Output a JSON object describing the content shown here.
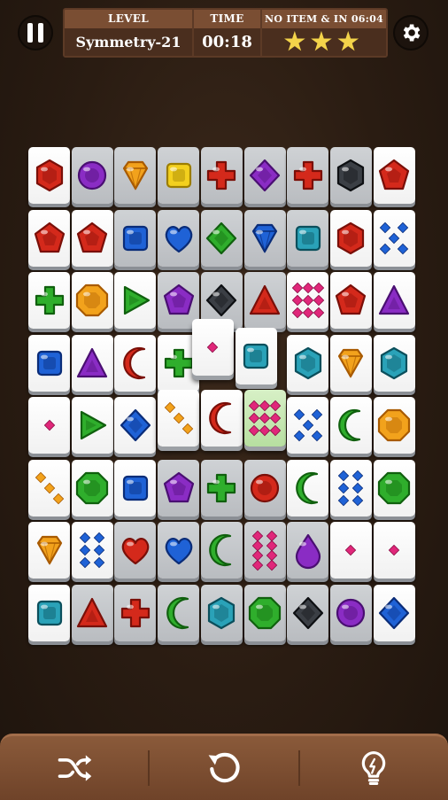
{
  "hud": {
    "level_label": "LEVEL",
    "level_value": "Symmetry-21",
    "time_label": "TIME",
    "time_value": "00:18",
    "goal_label": "NO ITEM & IN 06:04",
    "stars": "★★★"
  },
  "icons": {
    "pause": "pause-icon",
    "settings": "gear-icon",
    "shuffle": "shuffle-icon",
    "undo": "undo-icon",
    "hint": "lightbulb-icon"
  },
  "colors": {
    "hud_bg": "#7a4e33",
    "hud_value_bg": "#4a2e1e",
    "star": "#f3d34a",
    "bottom_bar": "#7a4d31"
  },
  "board": {
    "rows": [
      [
        {
          "g": "hex-red",
          "s": "free"
        },
        {
          "g": "circle-purple",
          "s": "blocked"
        },
        {
          "g": "diamond-orange",
          "s": "blocked"
        },
        {
          "g": "square-yellow",
          "s": "blocked"
        },
        {
          "g": "cross-red",
          "s": "blocked"
        },
        {
          "g": "rhombus-purple",
          "s": "blocked"
        },
        {
          "g": "cross-red",
          "s": "blocked"
        },
        {
          "g": "hex-black",
          "s": "blocked"
        },
        {
          "g": "pentagon-red",
          "s": "free"
        }
      ],
      [
        {
          "g": "pentagon-red",
          "s": "free"
        },
        {
          "g": "pentagon-red",
          "s": "free"
        },
        {
          "g": "square-blue",
          "s": "blocked"
        },
        {
          "g": "heart-blue",
          "s": "blocked"
        },
        {
          "g": "rhombus-green",
          "s": "blocked"
        },
        {
          "g": "diamond-blue",
          "s": "blocked"
        },
        {
          "g": "square-teal",
          "s": "blocked"
        },
        {
          "g": "hex-red",
          "s": "free"
        },
        {
          "g": "dots5-blue",
          "s": "free"
        }
      ],
      [
        {
          "g": "cross-green",
          "s": "free"
        },
        {
          "g": "oct-orange",
          "s": "free"
        },
        {
          "g": "triangle-green",
          "s": "free"
        },
        {
          "g": "pentagon-purple",
          "s": "blocked"
        },
        {
          "g": "rhombus-black",
          "s": "blocked"
        },
        {
          "g": "triangle-red",
          "s": "blocked"
        },
        {
          "g": "dots9-pink",
          "s": "free"
        },
        {
          "g": "pentagon-red",
          "s": "free"
        },
        {
          "g": "triangle-purple",
          "s": "free"
        }
      ],
      [
        {
          "g": "square-blue",
          "s": "free"
        },
        {
          "g": "triangle-purple",
          "s": "free"
        },
        {
          "g": "moon-red",
          "s": "free"
        },
        {
          "g": "cross-green",
          "s": "free"
        },
        {
          "g": "dots1-pink",
          "s": "free"
        },
        {
          "g": "square-teal",
          "s": "free"
        },
        {
          "g": "hex-teal",
          "s": "free"
        },
        {
          "g": "diamond-orange",
          "s": "free"
        },
        {
          "g": "hex-teal",
          "s": "free"
        }
      ],
      [
        {
          "g": "dots1-pink",
          "s": "free"
        },
        {
          "g": "triangle-green",
          "s": "free"
        },
        {
          "g": "rhombus-blue",
          "s": "free"
        },
        {
          "g": "dots3-orange",
          "s": "free"
        },
        {
          "g": "moon-red",
          "s": "free"
        },
        {
          "g": "dots9-pink",
          "s": "hl"
        },
        {
          "g": "dots5-blue",
          "s": "free"
        },
        {
          "g": "moon-green",
          "s": "free"
        },
        {
          "g": "oct-orange",
          "s": "free"
        }
      ],
      [
        {
          "g": "dots3-orange",
          "s": "free"
        },
        {
          "g": "oct-green",
          "s": "free"
        },
        {
          "g": "square-blue",
          "s": "free"
        },
        {
          "g": "pentagon-purple",
          "s": "blocked"
        },
        {
          "g": "cross-green",
          "s": "blocked"
        },
        {
          "g": "circle-red",
          "s": "blocked"
        },
        {
          "g": "moon-green",
          "s": "free"
        },
        {
          "g": "dots6-blue",
          "s": "free"
        },
        {
          "g": "oct-green",
          "s": "free"
        }
      ],
      [
        {
          "g": "diamond-orange",
          "s": "free"
        },
        {
          "g": "dots6-blue",
          "s": "free"
        },
        {
          "g": "heart-red",
          "s": "blocked"
        },
        {
          "g": "heart-blue",
          "s": "blocked"
        },
        {
          "g": "moon-green",
          "s": "blocked"
        },
        {
          "g": "dots8-pink",
          "s": "blocked"
        },
        {
          "g": "drop-purple",
          "s": "blocked"
        },
        {
          "g": "dots1-pink",
          "s": "free"
        },
        {
          "g": "dots1-pink",
          "s": "free"
        }
      ],
      [
        {
          "g": "square-teal",
          "s": "free"
        },
        {
          "g": "triangle-red",
          "s": "blocked"
        },
        {
          "g": "cross-red",
          "s": "blocked"
        },
        {
          "g": "moon-green",
          "s": "blocked"
        },
        {
          "g": "hex-teal",
          "s": "blocked"
        },
        {
          "g": "oct-green",
          "s": "blocked"
        },
        {
          "g": "rhombus-black",
          "s": "blocked"
        },
        {
          "g": "circle-purple",
          "s": "blocked"
        },
        {
          "g": "rhombus-blue",
          "s": "free"
        }
      ]
    ]
  }
}
